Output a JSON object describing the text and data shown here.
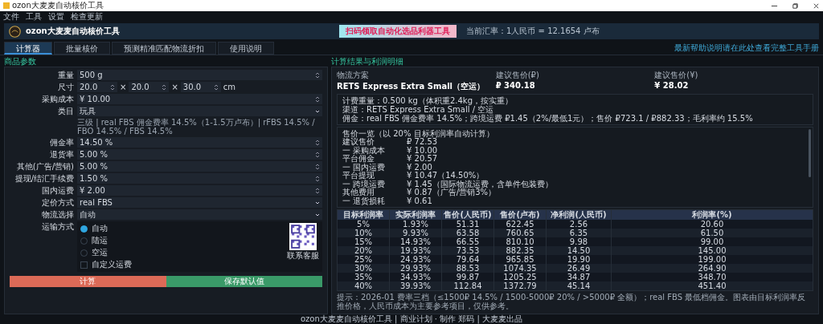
{
  "window": {
    "title": "ozon大麦麦自动核价工具"
  },
  "menu": [
    "文件",
    "工具",
    "设置",
    "检查更新"
  ],
  "header": {
    "title": "ozon大麦麦自动核价工具",
    "ad_text": "扫码领取自动化选品利器工具",
    "rate": "当前汇率：1人民币 = 12.1654 卢布"
  },
  "tabs": [
    {
      "label": "计算器",
      "selected": true
    },
    {
      "label": "批量核价",
      "selected": false
    },
    {
      "label": "预测精准匹配物流折扣",
      "selected": false
    },
    {
      "label": "使用说明",
      "selected": false
    }
  ],
  "help_link": "最新帮助说明请在此处查看完整工具手册",
  "left": {
    "title": "商品参数",
    "fields": [
      {
        "label": "重量",
        "kind": "spin",
        "value": "500 g"
      },
      {
        "label": "尺寸",
        "kind": "dims",
        "values": [
          "20.0",
          "20.0",
          "30.0"
        ],
        "separator": "×",
        "unit": "cm"
      },
      {
        "label": "采购成本",
        "kind": "spin",
        "value": "¥ 10.00"
      },
      {
        "label": "类目",
        "kind": "select",
        "value": "玩具"
      },
      {
        "kind": "note",
        "value": "三级 | real FBS 佣金费率 14.5%（1-1.5万卢布）| rFBS 14.5% / FBO 14.5% / FBS 14.5%"
      },
      {
        "label": "佣金率",
        "kind": "spin",
        "value": "14.50 %"
      },
      {
        "label": "退货率",
        "kind": "spin",
        "value": "5.00 %"
      },
      {
        "label": "其他(广告/营销)",
        "kind": "spin",
        "value": "5.00 %"
      },
      {
        "label": "提现/结汇手续费",
        "kind": "spin",
        "value": "1.50 %"
      },
      {
        "label": "国内运费",
        "kind": "spin",
        "value": "¥ 2.00"
      },
      {
        "label": "定价方式",
        "kind": "select",
        "value": "real FBS"
      },
      {
        "label": "物流选择",
        "kind": "select",
        "value": "自动"
      }
    ],
    "shipping": {
      "label": "运输方式",
      "options": [
        {
          "label": "自动",
          "kind": "radio",
          "selected": true
        },
        {
          "label": "陆运",
          "kind": "radio",
          "selected": false
        },
        {
          "label": "空运",
          "kind": "radio",
          "selected": false
        },
        {
          "label": "自定义运费",
          "kind": "checkbox",
          "checked": false
        }
      ],
      "qr_caption": "联系客服"
    },
    "buttons": [
      {
        "label": "计算",
        "kind": "danger"
      },
      {
        "label": "保存默认值",
        "kind": "success"
      }
    ]
  },
  "right": {
    "title": "计算结果与利润明细",
    "summary": [
      {
        "label": "物流方案",
        "value": "RETS Express Extra Small（空运）"
      },
      {
        "label": "建议售价(₽)",
        "value": "₽ 340.18"
      },
      {
        "label": "建议售价(¥)",
        "value": "¥ 28.02"
      }
    ],
    "info": [
      "计费重量：0.500 kg（体积重2.4kg，按实重）",
      "渠道：RETS Express Extra Small / 空运",
      "佣金：real FBS 佣金费率 14.5%；跨境运费 ₽1.45（2%/最低1元）；售价 ₽723.1 / ₽882.33；毛利率约 15.5%"
    ],
    "breakdown_title": "售价一览（以 20% 目标利润率自动计算）",
    "breakdown": [
      {
        "label": "建议售价",
        "value": "₽ 72.53"
      },
      {
        "label": "一 采购成本",
        "value": "¥ 10.00"
      },
      {
        "label": "平台佣金",
        "value": "¥ 20.57"
      },
      {
        "label": "一 国内运费",
        "value": "¥ 2.00"
      },
      {
        "label": "平台提现",
        "value": "¥ 10.47（14.50%）"
      },
      {
        "label": "一 跨境运费",
        "value": "¥ 1.45（国际物流运费，含单件包装费）"
      },
      {
        "label": "其他费用",
        "value": "¥ 0.87（广告/营销3%）"
      },
      {
        "label": "一 退货损耗",
        "value": "¥ 0.61"
      }
    ],
    "table": {
      "columns": [
        "目标利润率",
        "实际利润率",
        "售价(人民币)",
        "售价(卢布)",
        "净利润(人民币)",
        "利润率(%)"
      ],
      "rows": [
        [
          "5%",
          "1.93%",
          "51.31",
          "622.45",
          "2.56",
          "20.60"
        ],
        [
          "10%",
          "9.93%",
          "63.58",
          "760.65",
          "6.35",
          "61.50"
        ],
        [
          "15%",
          "14.93%",
          "66.55",
          "810.10",
          "9.98",
          "99.00"
        ],
        [
          "20%",
          "19.93%",
          "73.53",
          "882.35",
          "14.50",
          "145.00"
        ],
        [
          "25%",
          "24.93%",
          "79.64",
          "965.85",
          "19.90",
          "199.00"
        ],
        [
          "30%",
          "29.93%",
          "88.53",
          "1074.35",
          "26.49",
          "264.90"
        ],
        [
          "35%",
          "34.93%",
          "99.87",
          "1205.25",
          "34.87",
          "348.70"
        ],
        [
          "40%",
          "39.93%",
          "112.84",
          "1372.79",
          "45.14",
          "451.40"
        ]
      ]
    },
    "note": "提示：2026-01 费率三档（≤1500₽ 14.5% / 1500-5000₽ 20% / >5000₽ 全额）；real FBS 最低档佣金。图表由目标利润率反推价格，人民币成本为主要参考项目，仅供参考。"
  },
  "status_bar": "ozon大麦麦自动核价工具 | 商业计划 · 制作 郑码 | 大麦麦出品"
}
